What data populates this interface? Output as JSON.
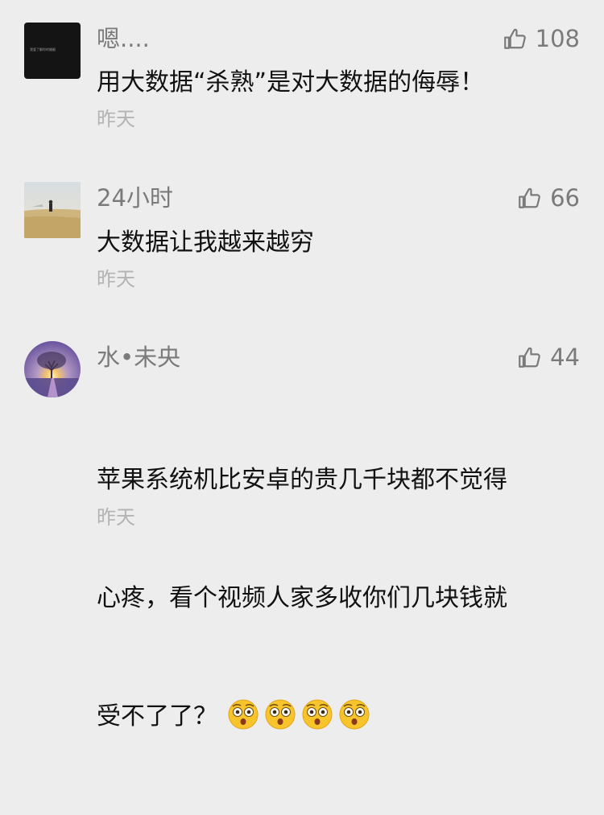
{
  "comments": [
    {
      "avatar_text": "我爱了解你的婚姻",
      "username": "嗯....",
      "likes": "108",
      "content": "用大数据“杀熟”是对大数据的侮辱！",
      "time": "昨天"
    },
    {
      "username": "24小时",
      "likes": "66",
      "content": "大数据让我越来越穷",
      "time": "昨天"
    },
    {
      "username": "水•未央",
      "likes": "44",
      "content_line1": "苹果系统机比安卓的贵几千块都不觉得",
      "content_line2": "心疼，看个视频人家多收你们几块钱就",
      "content_line3": "受不了了？",
      "emoji": "surprised-face-icon",
      "emoji_count": 4,
      "time": "昨天"
    }
  ]
}
